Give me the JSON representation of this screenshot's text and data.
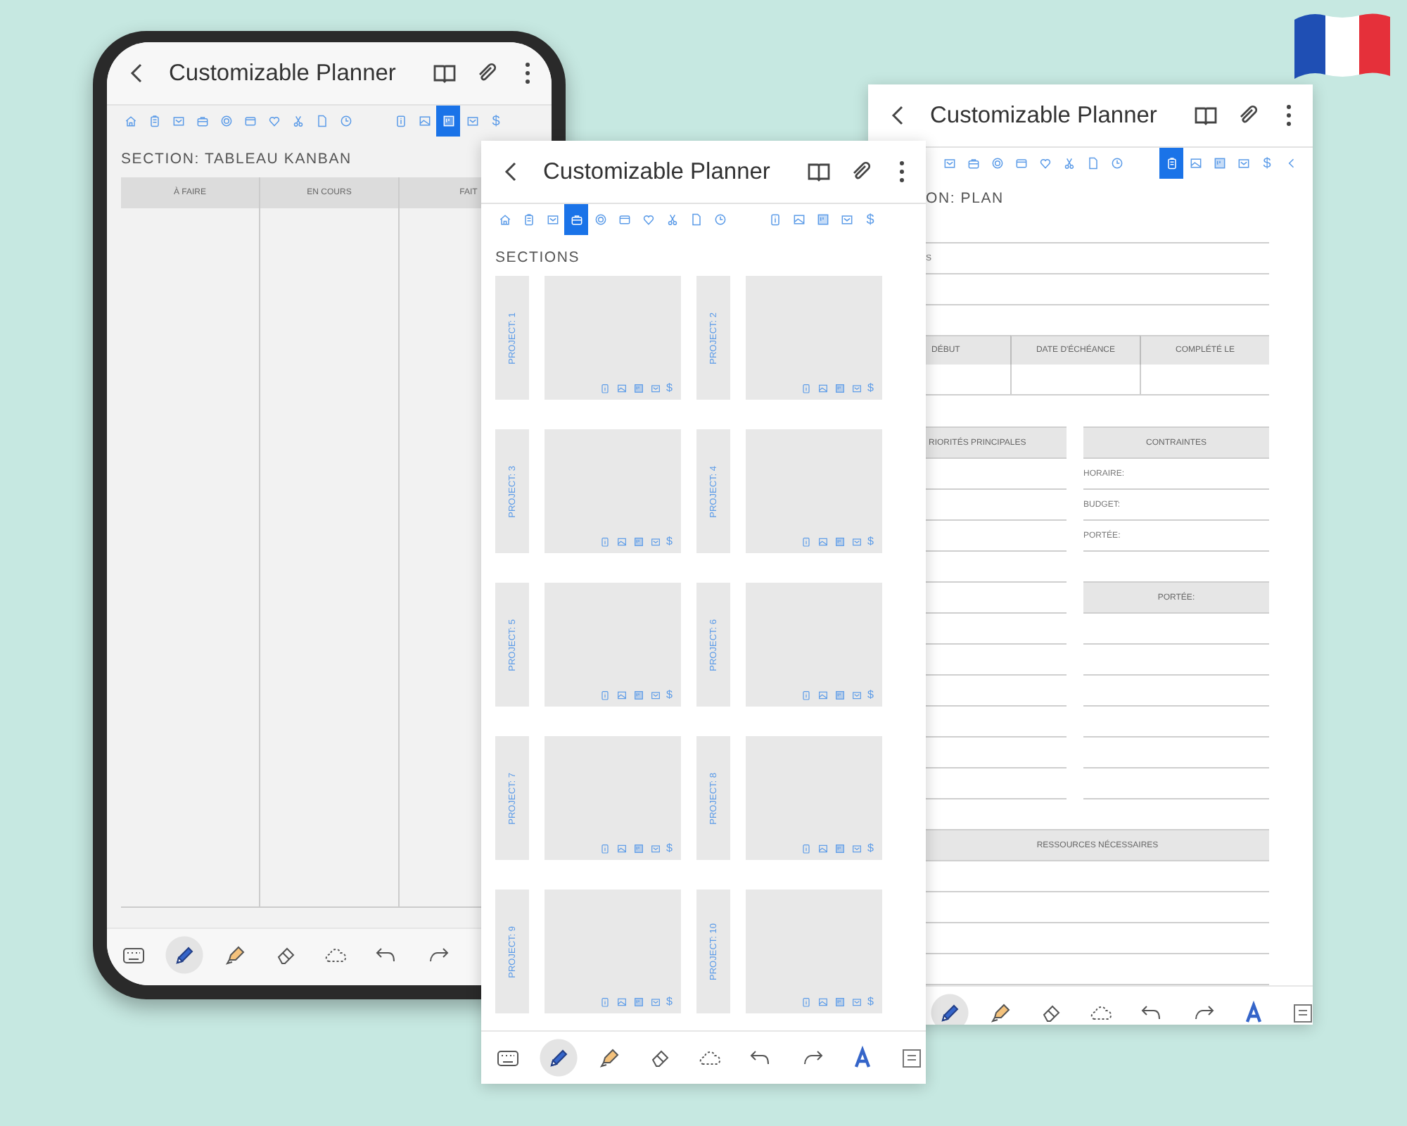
{
  "screens": [
    {
      "kind": "kanban",
      "title": "Customizable Planner",
      "tab_groups": [
        {
          "tabs": [
            {
              "kind": "home",
              "selected": false
            },
            {
              "kind": "clipboard",
              "selected": false
            },
            {
              "kind": "checkbox",
              "selected": false
            },
            {
              "kind": "briefcase",
              "selected": false
            },
            {
              "kind": "target",
              "selected": false
            },
            {
              "kind": "folder",
              "selected": false
            },
            {
              "kind": "heart",
              "selected": false
            },
            {
              "kind": "scissors",
              "selected": false
            },
            {
              "kind": "page",
              "selected": false
            },
            {
              "kind": "clock",
              "selected": false
            }
          ]
        },
        {
          "tabs": [
            {
              "kind": "info",
              "selected": false
            },
            {
              "kind": "image",
              "selected": false
            },
            {
              "kind": "board",
              "selected": true
            },
            {
              "kind": "checkbox",
              "selected": false
            },
            {
              "kind": "text",
              "label": "$",
              "selected": false
            }
          ]
        }
      ],
      "section_title": "SECTION: TABLEAU KANBAN",
      "columns": [
        "À FAIRE",
        "EN COURS",
        "FAIT"
      ],
      "toolbar": [
        {
          "kind": "keyboard",
          "selected": false
        },
        {
          "kind": "pen",
          "selected": true
        },
        {
          "kind": "highlighter",
          "selected": false
        },
        {
          "kind": "eraser",
          "selected": false
        },
        {
          "kind": "lasso",
          "selected": false
        },
        {
          "kind": "undo",
          "selected": false
        },
        {
          "kind": "redo",
          "selected": false
        }
      ]
    },
    {
      "kind": "sections",
      "title": "Customizable Planner",
      "tab_groups": [
        {
          "tabs": [
            {
              "kind": "home",
              "selected": false
            },
            {
              "kind": "clipboard",
              "selected": false
            },
            {
              "kind": "checkbox",
              "selected": false
            },
            {
              "kind": "briefcase",
              "selected": true
            },
            {
              "kind": "target",
              "selected": false
            },
            {
              "kind": "folder",
              "selected": false
            },
            {
              "kind": "heart",
              "selected": false
            },
            {
              "kind": "scissors",
              "selected": false
            },
            {
              "kind": "page",
              "selected": false
            },
            {
              "kind": "clock",
              "selected": false
            }
          ]
        },
        {
          "tabs": [
            {
              "kind": "info",
              "selected": false
            },
            {
              "kind": "image",
              "selected": false
            },
            {
              "kind": "board",
              "selected": false
            },
            {
              "kind": "checkbox",
              "selected": false
            },
            {
              "kind": "text",
              "label": "$",
              "selected": false
            }
          ]
        }
      ],
      "section_title": "SECTIONS",
      "projects": [
        {
          "label": "PROJECT: 1",
          "links": [
            {
              "kind": "info"
            },
            {
              "kind": "image"
            },
            {
              "kind": "board"
            },
            {
              "kind": "checkbox"
            },
            {
              "kind": "text",
              "label": "$"
            }
          ]
        },
        {
          "label": "PROJECT: 2",
          "links": [
            {
              "kind": "info"
            },
            {
              "kind": "image"
            },
            {
              "kind": "board"
            },
            {
              "kind": "checkbox"
            },
            {
              "kind": "text",
              "label": "$"
            }
          ]
        },
        {
          "label": "PROJECT: 3",
          "links": [
            {
              "kind": "info"
            },
            {
              "kind": "image"
            },
            {
              "kind": "board"
            },
            {
              "kind": "checkbox"
            },
            {
              "kind": "text",
              "label": "$"
            }
          ]
        },
        {
          "label": "PROJECT: 4",
          "links": [
            {
              "kind": "info"
            },
            {
              "kind": "image"
            },
            {
              "kind": "board"
            },
            {
              "kind": "checkbox"
            },
            {
              "kind": "text",
              "label": "$"
            }
          ]
        },
        {
          "label": "PROJECT: 5",
          "links": [
            {
              "kind": "info"
            },
            {
              "kind": "image"
            },
            {
              "kind": "board"
            },
            {
              "kind": "checkbox"
            },
            {
              "kind": "text",
              "label": "$"
            }
          ]
        },
        {
          "label": "PROJECT: 6",
          "links": [
            {
              "kind": "info"
            },
            {
              "kind": "image"
            },
            {
              "kind": "board"
            },
            {
              "kind": "checkbox"
            },
            {
              "kind": "text",
              "label": "$"
            }
          ]
        },
        {
          "label": "PROJECT: 7",
          "links": [
            {
              "kind": "info"
            },
            {
              "kind": "image"
            },
            {
              "kind": "board"
            },
            {
              "kind": "checkbox"
            },
            {
              "kind": "text",
              "label": "$"
            }
          ]
        },
        {
          "label": "PROJECT: 8",
          "links": [
            {
              "kind": "info"
            },
            {
              "kind": "image"
            },
            {
              "kind": "board"
            },
            {
              "kind": "checkbox"
            },
            {
              "kind": "text",
              "label": "$"
            }
          ]
        },
        {
          "label": "PROJECT: 9",
          "links": [
            {
              "kind": "info"
            },
            {
              "kind": "image"
            },
            {
              "kind": "board"
            },
            {
              "kind": "checkbox"
            },
            {
              "kind": "text",
              "label": "$"
            }
          ]
        },
        {
          "label": "PROJECT: 10",
          "links": [
            {
              "kind": "info"
            },
            {
              "kind": "image"
            },
            {
              "kind": "board"
            },
            {
              "kind": "checkbox"
            },
            {
              "kind": "text",
              "label": "$"
            }
          ]
        }
      ],
      "toolbar": [
        {
          "kind": "keyboard",
          "selected": false
        },
        {
          "kind": "pen",
          "selected": true
        },
        {
          "kind": "highlighter",
          "selected": false
        },
        {
          "kind": "eraser",
          "selected": false
        },
        {
          "kind": "lasso",
          "selected": false
        },
        {
          "kind": "undo",
          "selected": false
        },
        {
          "kind": "redo",
          "selected": false
        },
        {
          "kind": "text-style",
          "selected": false
        },
        {
          "kind": "text-box",
          "selected": false
        }
      ]
    },
    {
      "kind": "plan",
      "title": "Customizable Planner",
      "tab_groups": [
        {
          "tabs": [
            {
              "kind": "checkbox",
              "selected": false
            },
            {
              "kind": "briefcase",
              "selected": false
            },
            {
              "kind": "target",
              "selected": false
            },
            {
              "kind": "folder",
              "selected": false
            },
            {
              "kind": "heart",
              "selected": false
            },
            {
              "kind": "scissors",
              "selected": false
            },
            {
              "kind": "page",
              "selected": false
            },
            {
              "kind": "clock",
              "selected": false
            }
          ]
        },
        {
          "tabs": [
            {
              "kind": "clipboard",
              "selected": true
            },
            {
              "kind": "image",
              "selected": false
            },
            {
              "kind": "board",
              "selected": false
            },
            {
              "kind": "checkbox",
              "selected": false
            },
            {
              "kind": "text",
              "label": "$",
              "selected": false
            },
            {
              "kind": "chevron",
              "selected": false
            }
          ]
        }
      ],
      "section_title": "ON: PLAN",
      "field_label": "S",
      "date_columns": [
        "DÉBUT",
        "DATE D'ÉCHÉANCE",
        "COMPLÉTÉ LE"
      ],
      "priorities_heading": "RIORITÉS PRINCIPALES",
      "constraints": {
        "heading": "CONTRAINTES",
        "items": [
          "HORAIRE:",
          "BUDGET:",
          "PORTÉE:"
        ]
      },
      "scope_heading": "PORTÉE:",
      "resources_heading": "RESSOURCES NÉCESSAIRES",
      "toolbar": [
        {
          "kind": "pen",
          "selected": true
        },
        {
          "kind": "highlighter",
          "selected": false
        },
        {
          "kind": "eraser",
          "selected": false
        },
        {
          "kind": "lasso",
          "selected": false
        },
        {
          "kind": "undo",
          "selected": false
        },
        {
          "kind": "redo",
          "selected": false
        },
        {
          "kind": "text-style",
          "selected": false
        },
        {
          "kind": "text-box",
          "selected": false
        }
      ]
    }
  ]
}
